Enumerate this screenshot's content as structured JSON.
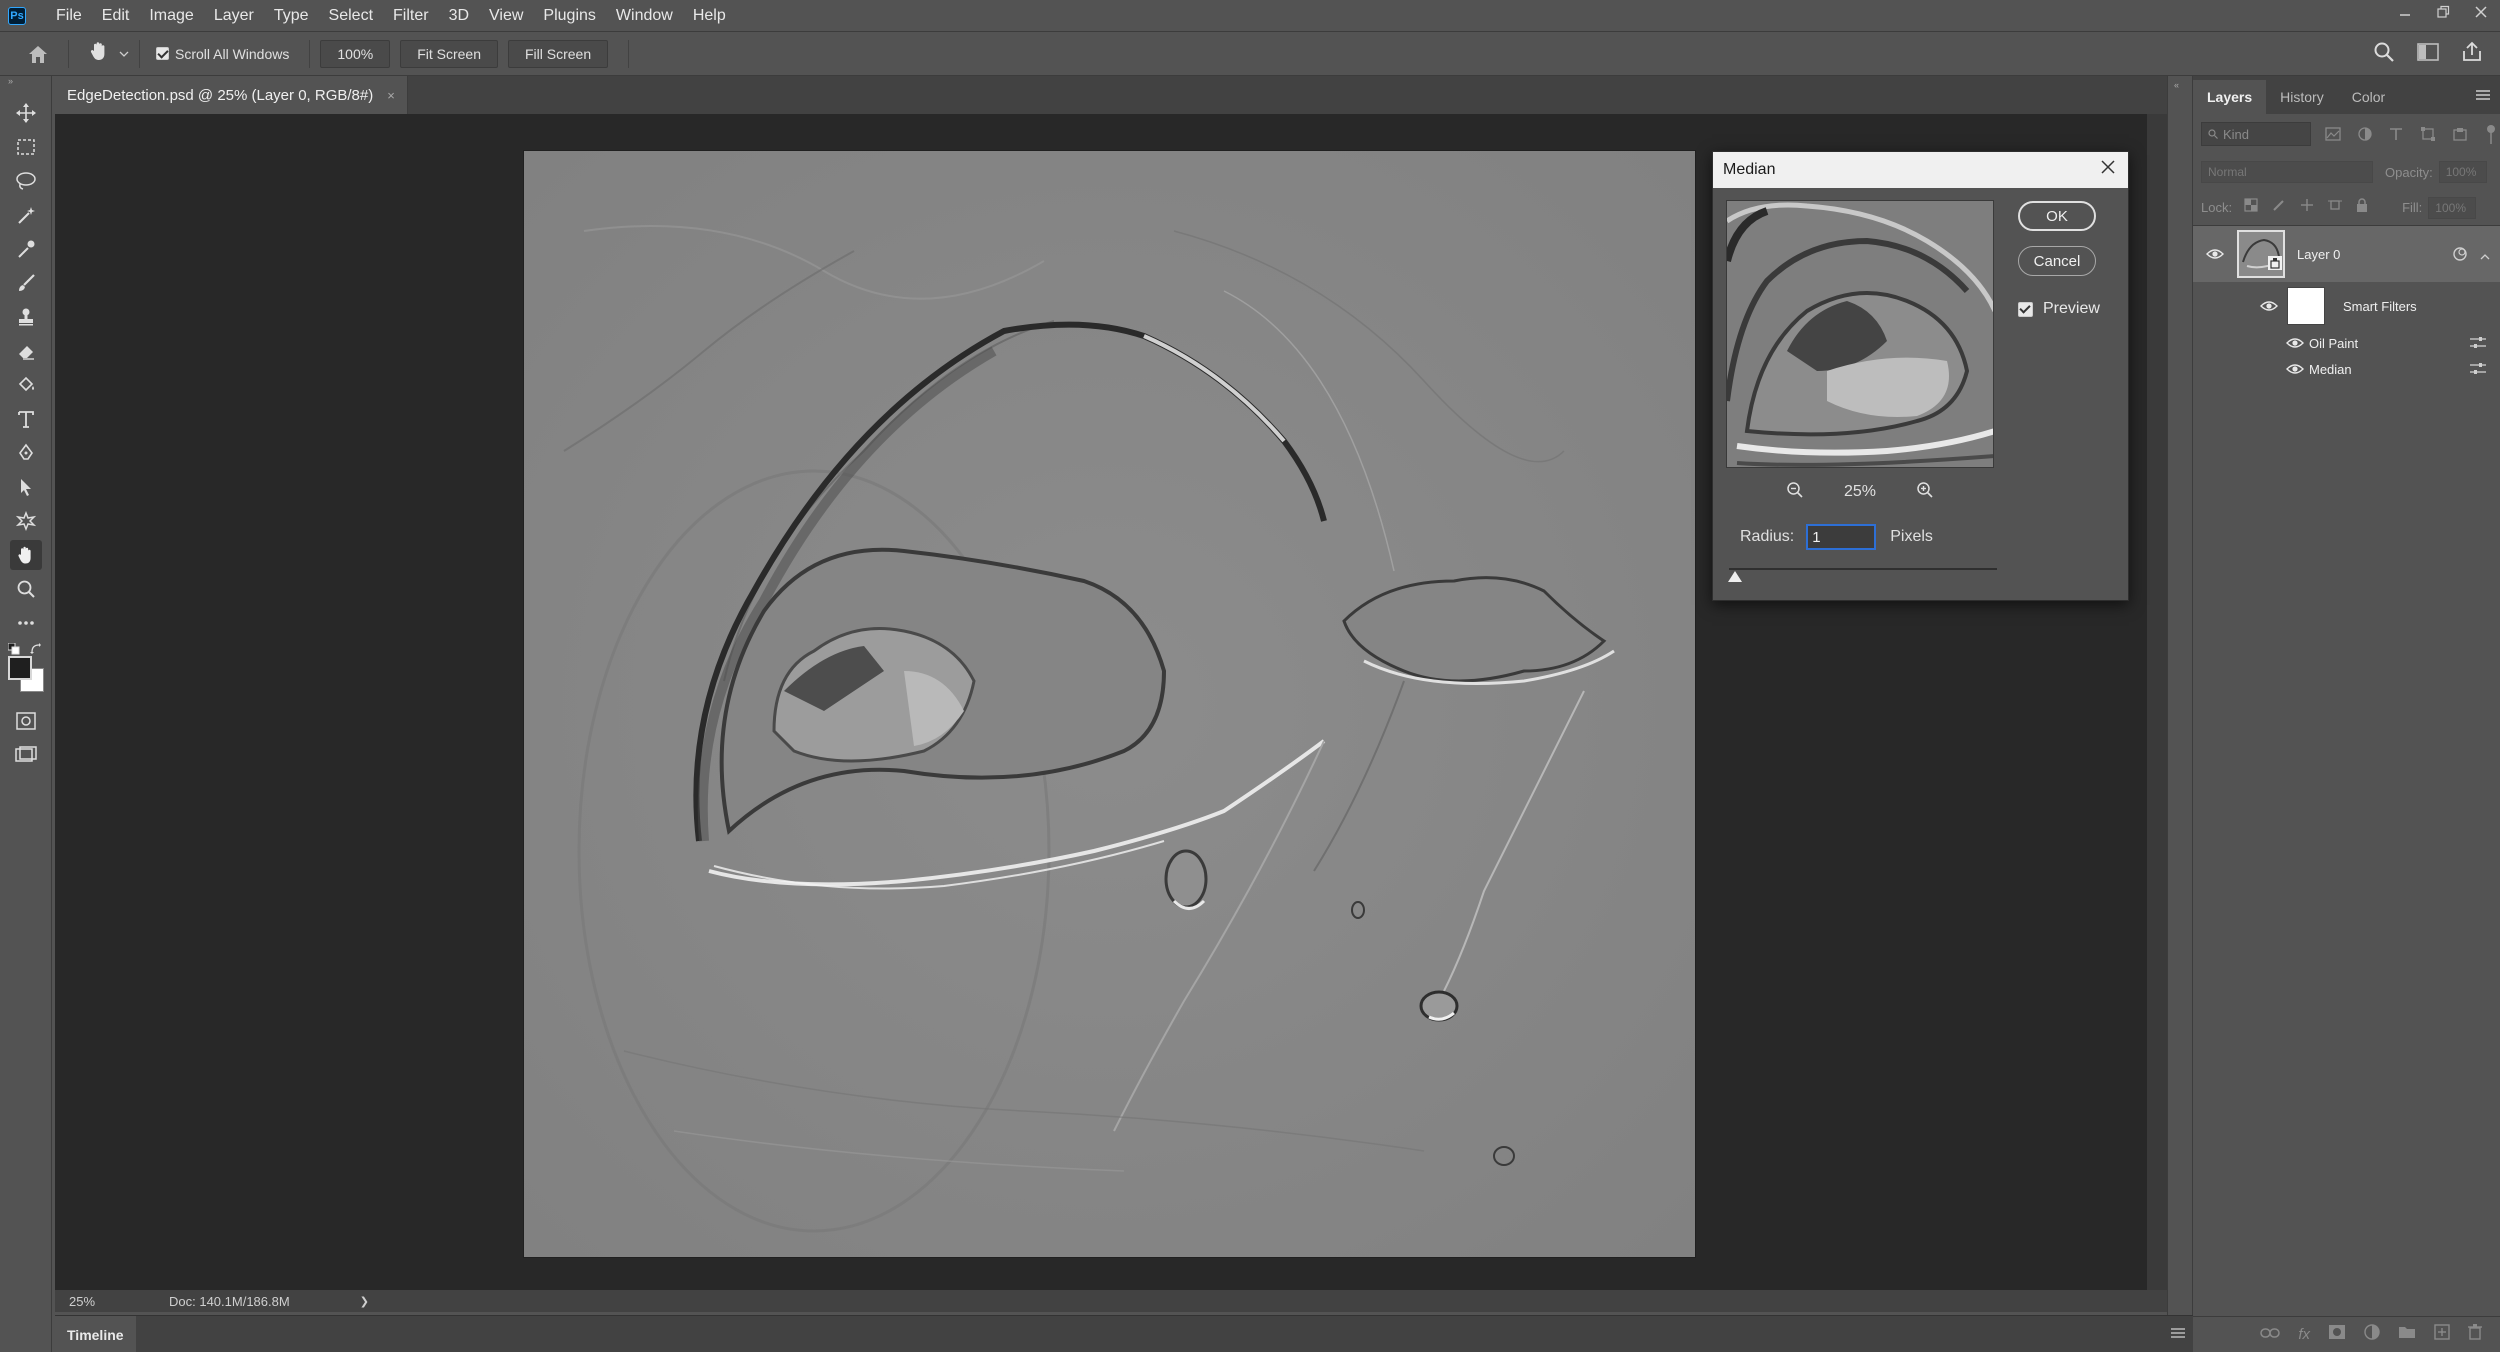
{
  "menubar": {
    "app_icon": "Ps",
    "items": [
      "File",
      "Edit",
      "Image",
      "Layer",
      "Type",
      "Select",
      "Filter",
      "3D",
      "View",
      "Plugins",
      "Window",
      "Help"
    ],
    "window_controls": [
      "minimize-icon",
      "restore-icon",
      "close-icon"
    ]
  },
  "options": {
    "home_icon": "home-icon",
    "tool_icon": "hand-icon",
    "scroll_all_windows": "Scroll All Windows",
    "zoom_btn": "100%",
    "fit_screen": "Fit Screen",
    "fill_screen": "Fill Screen"
  },
  "toolbar": {
    "tools": [
      "move-tool-icon",
      "marquee-tool-icon",
      "lasso-tool-icon",
      "magic-wand-tool-icon",
      "eyedropper-tool-icon",
      "brush-tool-icon",
      "stamp-tool-icon",
      "eraser-tool-icon",
      "paint-bucket-tool-icon",
      "type-tool-icon",
      "pen-tool-icon",
      "path-selection-tool-icon",
      "custom-shape-tool-icon",
      "hand-tool-icon",
      "zoom-tool-icon",
      "more-tools-icon"
    ],
    "active_tool": "hand-tool-icon",
    "foreground_color": "#1f1f1f",
    "background_color": "#ffffff"
  },
  "document": {
    "tab_title": "EdgeDetection.psd @ 25% (Layer 0, RGB/8#)",
    "close": "×"
  },
  "status": {
    "zoom": "25%",
    "doc_size": "Doc: 140.1M/186.8M",
    "arrow": "❯"
  },
  "timeline": {
    "label": "Timeline"
  },
  "dialog": {
    "title": "Median",
    "ok": "OK",
    "cancel": "Cancel",
    "preview_label": "Preview",
    "preview_checked": true,
    "zoom_level": "25%",
    "radius_label": "Radius:",
    "radius_value": "1",
    "unit": "Pixels"
  },
  "panel": {
    "tabs": [
      "Layers",
      "History",
      "Color"
    ],
    "active_tab": "Layers",
    "kind_placeholder": "Kind",
    "blend_mode": "Normal",
    "opacity_label": "Opacity:",
    "opacity_value": "100%",
    "lock_label": "Lock:",
    "fill_label": "Fill:",
    "fill_value": "100%",
    "layers": [
      {
        "name": "Layer 0"
      },
      {
        "name": "Smart Filters"
      },
      {
        "name": "Oil Paint"
      },
      {
        "name": "Median"
      }
    ]
  },
  "colors": {
    "ui_bg": "#535353",
    "dark_bg": "#282828",
    "accent_blue": "#2d6fd6"
  }
}
